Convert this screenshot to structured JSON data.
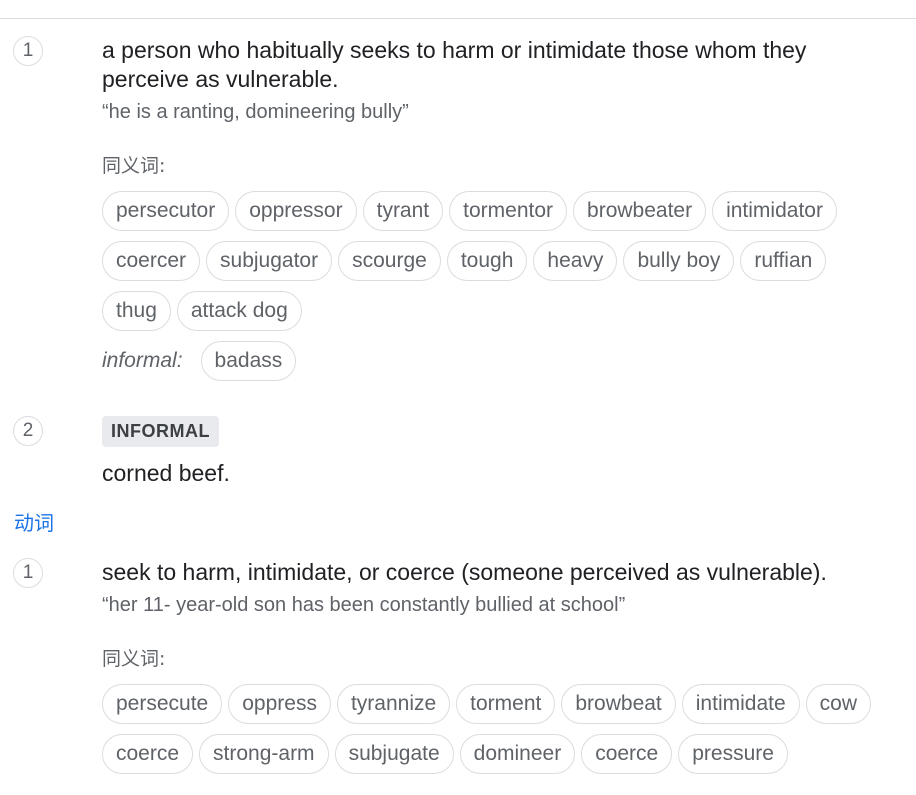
{
  "noun": {
    "senses": [
      {
        "number": "1",
        "definition": "a person who habitually seeks to harm or intimidate those whom they perceive as vulnerable.",
        "example": "“he is a ranting, domineering bully”",
        "synonyms_label": "同义词:",
        "synonyms": [
          "persecutor",
          "oppressor",
          "tyrant",
          "tormentor",
          "browbeater",
          "intimidator",
          "coercer",
          "subjugator",
          "scourge",
          "tough",
          "heavy",
          "bully boy",
          "ruffian",
          "thug",
          "attack dog"
        ],
        "informal_label": "informal:",
        "informal_synonyms": [
          "badass"
        ]
      },
      {
        "number": "2",
        "register": "INFORMAL",
        "definition": "corned beef."
      }
    ]
  },
  "verb": {
    "pos_label": "动词",
    "senses": [
      {
        "number": "1",
        "definition": "seek to harm, intimidate, or coerce (someone perceived as vulnerable).",
        "example": "“her 11- year-old son has been constantly bullied at school”",
        "synonyms_label": "同义词:",
        "synonyms": [
          "persecute",
          "oppress",
          "tyrannize",
          "torment",
          "browbeat",
          "intimidate",
          "cow",
          "coerce",
          "strong-arm",
          "subjugate",
          "domineer",
          "coerce",
          "pressure"
        ]
      }
    ]
  }
}
